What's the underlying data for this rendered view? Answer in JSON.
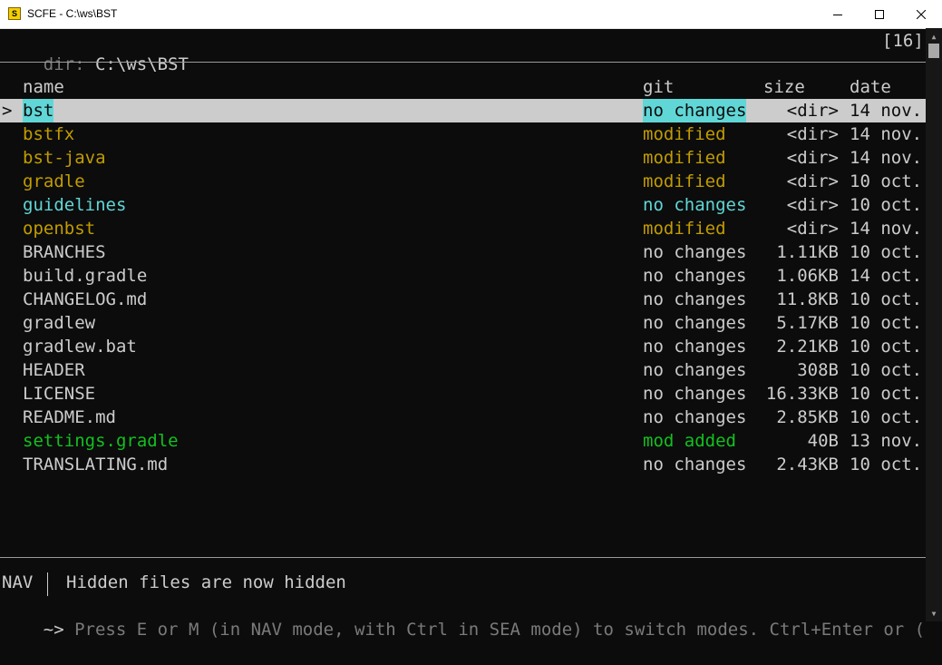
{
  "window": {
    "title": "SCFE - C:\\ws\\BST",
    "icon": "scfe-app-icon",
    "controls": [
      "minimize-icon",
      "maximize-icon",
      "close-icon"
    ]
  },
  "header": {
    "dir_label": "dir:",
    "dir_path": "C:\\ws\\BST",
    "count": "[16]"
  },
  "columns": {
    "name": "name",
    "git": "git",
    "size": "size",
    "date": "date"
  },
  "selection_pointer": ">",
  "files": [
    {
      "name": "bst",
      "git": "no changes",
      "size": "<dir>",
      "date": "14 nov.",
      "status": "selected"
    },
    {
      "name": "bstfx",
      "git": "modified",
      "size": "<dir>",
      "date": "14 nov.",
      "status": "modified"
    },
    {
      "name": "bst-java",
      "git": "modified",
      "size": "<dir>",
      "date": "14 nov.",
      "status": "modified"
    },
    {
      "name": "gradle",
      "git": "modified",
      "size": "<dir>",
      "date": "10 oct.",
      "status": "modified"
    },
    {
      "name": "guidelines",
      "git": "no changes",
      "size": "<dir>",
      "date": "10 oct.",
      "status": "dir-clean"
    },
    {
      "name": "openbst",
      "git": "modified",
      "size": "<dir>",
      "date": "14 nov.",
      "status": "modified"
    },
    {
      "name": "BRANCHES",
      "git": "no changes",
      "size": "1.11KB",
      "date": "10 oct.",
      "status": "clean"
    },
    {
      "name": "build.gradle",
      "git": "no changes",
      "size": "1.06KB",
      "date": "14 oct.",
      "status": "clean"
    },
    {
      "name": "CHANGELOG.md",
      "git": "no changes",
      "size": "11.8KB",
      "date": "10 oct.",
      "status": "clean"
    },
    {
      "name": "gradlew",
      "git": "no changes",
      "size": "5.17KB",
      "date": "10 oct.",
      "status": "clean"
    },
    {
      "name": "gradlew.bat",
      "git": "no changes",
      "size": "2.21KB",
      "date": "10 oct.",
      "status": "clean"
    },
    {
      "name": "HEADER",
      "git": "no changes",
      "size": "308B",
      "date": "10 oct.",
      "status": "clean"
    },
    {
      "name": "LICENSE",
      "git": "no changes",
      "size": "16.33KB",
      "date": "10 oct.",
      "status": "clean"
    },
    {
      "name": "README.md",
      "git": "no changes",
      "size": "2.85KB",
      "date": "10 oct.",
      "status": "clean"
    },
    {
      "name": "settings.gradle",
      "git": "mod added",
      "size": "40B",
      "date": "13 nov.",
      "status": "added"
    },
    {
      "name": "TRANSLATING.md",
      "git": "no changes",
      "size": "2.43KB",
      "date": "10 oct.",
      "status": "clean"
    }
  ],
  "status_bar": {
    "mode": "NAV",
    "message": "Hidden files are now hidden"
  },
  "command_line": {
    "prompt": "~>",
    "hint": "Press E or M (in NAV mode, with Ctrl in SEA mode) to switch modes. Ctrl+Enter or ("
  },
  "colors": {
    "background": "#0c0c0c",
    "text": "#cccccc",
    "modified": "#c19c00",
    "highlight_cyan": "#61d6d6",
    "added_green": "#13c01f",
    "selection_bar": "#cccccc",
    "dim": "#7a7a7a"
  }
}
